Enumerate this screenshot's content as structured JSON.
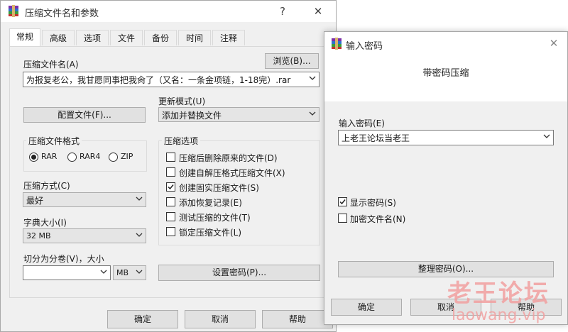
{
  "main": {
    "title": "压缩文件名和参数",
    "help_glyph": "?",
    "close_glyph": "✕",
    "tabs": [
      "常规",
      "高级",
      "选项",
      "文件",
      "备份",
      "时间",
      "注释"
    ],
    "archive_name_label": "压缩文件名(A)",
    "browse_label": "浏览(B)...",
    "archive_name_value": "为报复老公，我甘愿同事把我肏了（又名：一条金项链，1-18完）.rar",
    "update_mode_label": "更新模式(U)",
    "update_mode_value": "添加并替换文件",
    "profiles_label": "配置文件(F)...",
    "format_group": "压缩文件格式",
    "formats": [
      "RAR",
      "RAR4",
      "ZIP"
    ],
    "selected_format": "RAR",
    "method_label": "压缩方式(C)",
    "method_value": "最好",
    "dict_label": "字典大小(I)",
    "dict_value": "32 MB",
    "split_label": "切分为分卷(V)，大小",
    "split_value": "",
    "split_unit": "MB",
    "options_group": "压缩选项",
    "options": [
      {
        "label": "压缩后删除原来的文件(D)",
        "checked": false
      },
      {
        "label": "创建自解压格式压缩文件(X)",
        "checked": false
      },
      {
        "label": "创建固实压缩文件(S)",
        "checked": true
      },
      {
        "label": "添加恢复记录(E)",
        "checked": false
      },
      {
        "label": "测试压缩的文件(T)",
        "checked": false
      },
      {
        "label": "锁定压缩文件(L)",
        "checked": false
      }
    ],
    "set_password_label": "设置密码(P)...",
    "ok_label": "确定",
    "cancel_label": "取消",
    "help_label": "帮助"
  },
  "password": {
    "title": "输入密码",
    "close_glyph": "✕",
    "header": "带密码压缩",
    "input_label": "输入密码(E)",
    "input_value": "上老王论坛当老王",
    "show_password_label": "显示密码(S)",
    "show_password_checked": true,
    "encrypt_names_label": "加密文件名(N)",
    "encrypt_names_checked": false,
    "organize_label": "整理密码(O)...",
    "ok_label": "确定",
    "cancel_label": "取消",
    "help_label": "帮助"
  },
  "watermark": {
    "text_cn": "老王论坛",
    "text_url": "laowang.vip",
    "color": "#f2a0a0"
  }
}
